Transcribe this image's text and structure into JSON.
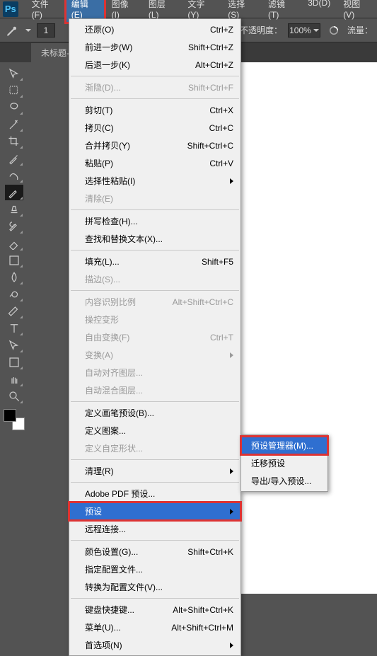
{
  "menubar": {
    "logo": "Ps",
    "items": [
      "文件(F)",
      "编辑(E)",
      "图像(I)",
      "图层(L)",
      "文字(Y)",
      "选择(S)",
      "滤镜(T)",
      "3D(D)",
      "视图(V)"
    ],
    "open_index": 1
  },
  "toolbar": {
    "brush_num": "1",
    "opacity_label": "不透明度：",
    "opacity_value": "100%",
    "flow_label": "流量："
  },
  "tab": {
    "title": "未标题-"
  },
  "swatches": {
    "fg": "#000000",
    "bg": "#ffffff"
  },
  "edit_menu": [
    {
      "type": "item",
      "label": "还原(O)",
      "shortcut": "Ctrl+Z"
    },
    {
      "type": "item",
      "label": "前进一步(W)",
      "shortcut": "Shift+Ctrl+Z"
    },
    {
      "type": "item",
      "label": "后退一步(K)",
      "shortcut": "Alt+Ctrl+Z"
    },
    {
      "type": "sep"
    },
    {
      "type": "item",
      "label": "渐隐(D)...",
      "shortcut": "Shift+Ctrl+F",
      "disabled": true
    },
    {
      "type": "sep"
    },
    {
      "type": "item",
      "label": "剪切(T)",
      "shortcut": "Ctrl+X"
    },
    {
      "type": "item",
      "label": "拷贝(C)",
      "shortcut": "Ctrl+C"
    },
    {
      "type": "item",
      "label": "合并拷贝(Y)",
      "shortcut": "Shift+Ctrl+C"
    },
    {
      "type": "item",
      "label": "粘贴(P)",
      "shortcut": "Ctrl+V"
    },
    {
      "type": "item",
      "label": "选择性粘贴(I)",
      "submenu": true
    },
    {
      "type": "item",
      "label": "清除(E)",
      "disabled": true
    },
    {
      "type": "sep"
    },
    {
      "type": "item",
      "label": "拼写检查(H)..."
    },
    {
      "type": "item",
      "label": "查找和替换文本(X)..."
    },
    {
      "type": "sep"
    },
    {
      "type": "item",
      "label": "填充(L)...",
      "shortcut": "Shift+F5"
    },
    {
      "type": "item",
      "label": "描边(S)...",
      "disabled": true
    },
    {
      "type": "sep"
    },
    {
      "type": "item",
      "label": "内容识别比例",
      "shortcut": "Alt+Shift+Ctrl+C",
      "disabled": true
    },
    {
      "type": "item",
      "label": "操控变形",
      "disabled": true
    },
    {
      "type": "item",
      "label": "自由变换(F)",
      "shortcut": "Ctrl+T",
      "disabled": true
    },
    {
      "type": "item",
      "label": "变换(A)",
      "submenu": true,
      "disabled": true
    },
    {
      "type": "item",
      "label": "自动对齐图层...",
      "disabled": true
    },
    {
      "type": "item",
      "label": "自动混合图层...",
      "disabled": true
    },
    {
      "type": "sep"
    },
    {
      "type": "item",
      "label": "定义画笔预设(B)..."
    },
    {
      "type": "item",
      "label": "定义图案..."
    },
    {
      "type": "item",
      "label": "定义自定形状...",
      "disabled": true
    },
    {
      "type": "sep"
    },
    {
      "type": "item",
      "label": "清理(R)",
      "submenu": true
    },
    {
      "type": "sep"
    },
    {
      "type": "item",
      "label": "Adobe PDF 预设..."
    },
    {
      "type": "item",
      "label": "预设",
      "submenu": true,
      "highlight": true
    },
    {
      "type": "item",
      "label": "远程连接..."
    },
    {
      "type": "sep"
    },
    {
      "type": "item",
      "label": "颜色设置(G)...",
      "shortcut": "Shift+Ctrl+K"
    },
    {
      "type": "item",
      "label": "指定配置文件..."
    },
    {
      "type": "item",
      "label": "转换为配置文件(V)..."
    },
    {
      "type": "sep"
    },
    {
      "type": "item",
      "label": "键盘快捷键...",
      "shortcut": "Alt+Shift+Ctrl+K"
    },
    {
      "type": "item",
      "label": "菜单(U)...",
      "shortcut": "Alt+Shift+Ctrl+M"
    },
    {
      "type": "item",
      "label": "首选项(N)",
      "submenu": true
    }
  ],
  "preset_submenu": [
    {
      "label": "预设管理器(M)...",
      "highlight": true
    },
    {
      "label": "迁移预设"
    },
    {
      "label": "导出/导入预设..."
    }
  ]
}
